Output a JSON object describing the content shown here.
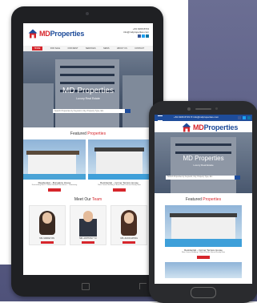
{
  "tablet": {
    "brand": {
      "prefix": "MD",
      "suffix": "Properties"
    },
    "contact": {
      "phone": "+63 9166 8723",
      "email": "info@mdproperties.com"
    },
    "menu": [
      "HOME",
      "FOR SALE",
      "FOR RENT",
      "SERVICES",
      "NEWS",
      "ABOUT US",
      "CONTACT"
    ],
    "hero": {
      "title": "MD Properties",
      "subtitle": "Luxury Real Estate",
      "search_placeholder": "Search Properties by Keyword, City, Property Type, Etc."
    },
    "featured": {
      "heading_a": "Featured ",
      "heading_b": "Properties"
    },
    "cards": [
      {
        "title": "Residential – Bungalow House",
        "desc": "Fascinating Bed / 2 Baths Modern Residence – Swimming"
      },
      {
        "title": "Residential – Corner Terrace House",
        "desc": "New Corner Building 3 Bed-4 Baths House Ready Now"
      }
    ],
    "team": {
      "heading_a": "Meet Our ",
      "heading_b": "Team",
      "members": [
        "MS. MARIE TAN",
        "MR. ANTHONY YU",
        "MS. ALICIA WONG"
      ]
    }
  },
  "phone": {
    "topbar": "+63 9166 8723 ✉ info@mdproperties.com",
    "brand": {
      "prefix": "MD",
      "suffix": "Properties"
    },
    "hero": {
      "title": "MD Properties",
      "subtitle": "Luxury Real Estate",
      "search_placeholder": "Search Properties by Keyword, City, Property Type, Etc."
    },
    "featured": {
      "heading_a": "Featured ",
      "heading_b": "Properties"
    },
    "card": {
      "title": "Residential – Corner Terrace House",
      "desc": "New Corner Building, 3 Bed-4 Baths House Ready Now"
    }
  },
  "colors": {
    "brand_blue": "#1e4c9a",
    "brand_red": "#d6252b",
    "backdrop": "#5a5d82"
  }
}
